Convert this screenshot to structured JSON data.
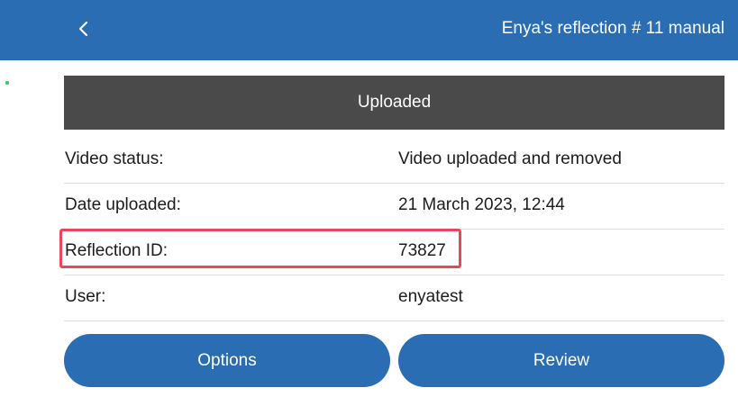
{
  "header": {
    "title": "Enya's reflection # 11 manual",
    "back_icon": "chevron-left-icon"
  },
  "status_banner": "Uploaded",
  "details": [
    {
      "label": "Video status:",
      "value": "Video uploaded and removed"
    },
    {
      "label": "Date uploaded:",
      "value": "21 March 2023, 12:44"
    },
    {
      "label": "Reflection ID:",
      "value": "73827"
    },
    {
      "label": "User:",
      "value": "enyatest"
    }
  ],
  "buttons": {
    "options_label": "Options",
    "review_label": "Review"
  },
  "colors": {
    "primary": "#2a6db3",
    "banner": "#4a4a4a",
    "highlight": "#e8485a"
  }
}
